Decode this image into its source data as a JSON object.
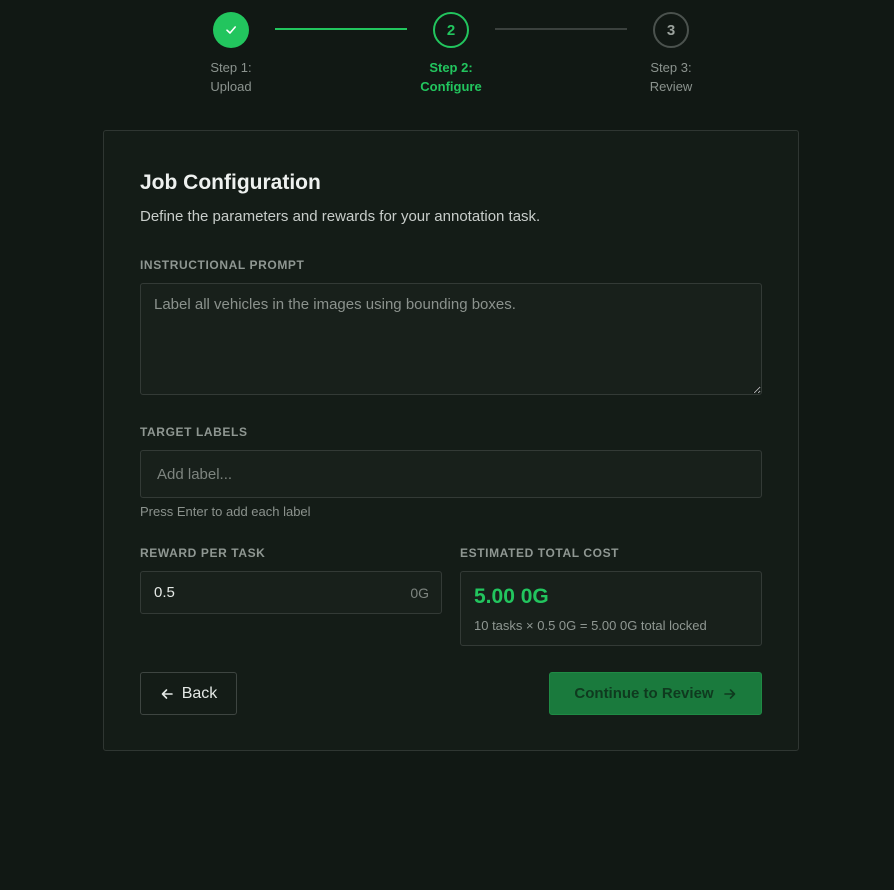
{
  "stepper": {
    "steps": [
      {
        "line1": "Step 1:",
        "line2": "Upload",
        "status": "complete",
        "number": "1",
        "icon": "check-icon"
      },
      {
        "line1": "Step 2:",
        "line2": "Configure",
        "status": "active",
        "number": "2"
      },
      {
        "line1": "Step 3:",
        "line2": "Review",
        "status": "pending",
        "number": "3"
      }
    ]
  },
  "card": {
    "title": "Job Configuration",
    "subtitle": "Define the parameters and rewards for your annotation task."
  },
  "prompt": {
    "label": "INSTRUCTIONAL PROMPT",
    "placeholder": "Label all vehicles in the images using bounding boxes.",
    "value": ""
  },
  "target_labels": {
    "label": "TARGET LABELS",
    "placeholder": "Add label...",
    "hint": "Press Enter to add each label"
  },
  "reward": {
    "label": "REWARD PER TASK",
    "value": "0.5",
    "unit": "0G"
  },
  "cost": {
    "label": "ESTIMATED TOTAL COST",
    "amount": "5.00 0G",
    "detail": "10 tasks × 0.5 0G = 5.00 0G total locked"
  },
  "actions": {
    "back_label": "Back",
    "back_icon": "arrow-left-icon",
    "continue_label": "Continue to Review",
    "continue_icon": "arrow-right-icon"
  },
  "colors": {
    "accent": "#22c55e",
    "background": "#111814",
    "card": "#141c17",
    "button_primary": "#1a7a3d"
  }
}
